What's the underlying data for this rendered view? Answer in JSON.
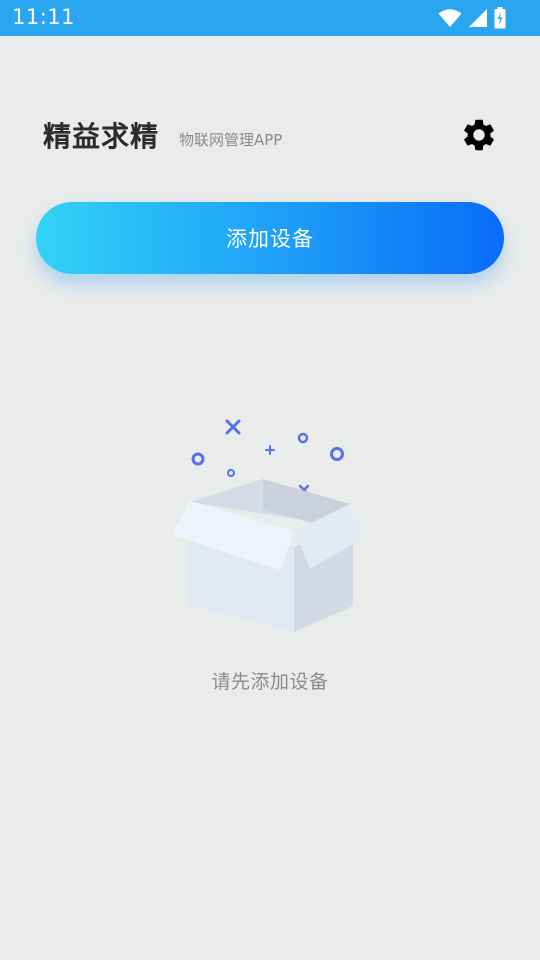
{
  "status_bar": {
    "time": "11:11",
    "icons": [
      "wifi-icon",
      "cell-signal-icon",
      "battery-charging-icon"
    ],
    "color": "#2aa6f0"
  },
  "header": {
    "title": "精益求精",
    "subtitle": "物联网管理APP",
    "settings_icon": "gear-icon"
  },
  "main": {
    "add_device_label": "添加设备",
    "empty_state_text": "请先添加设备",
    "empty_state_icon": "open-box-icon"
  },
  "colors": {
    "background": "#eaeceb",
    "button_gradient_start": "#33d2f7",
    "button_gradient_end": "#0a6cf9",
    "accent_sparkle": "#5573e6"
  }
}
